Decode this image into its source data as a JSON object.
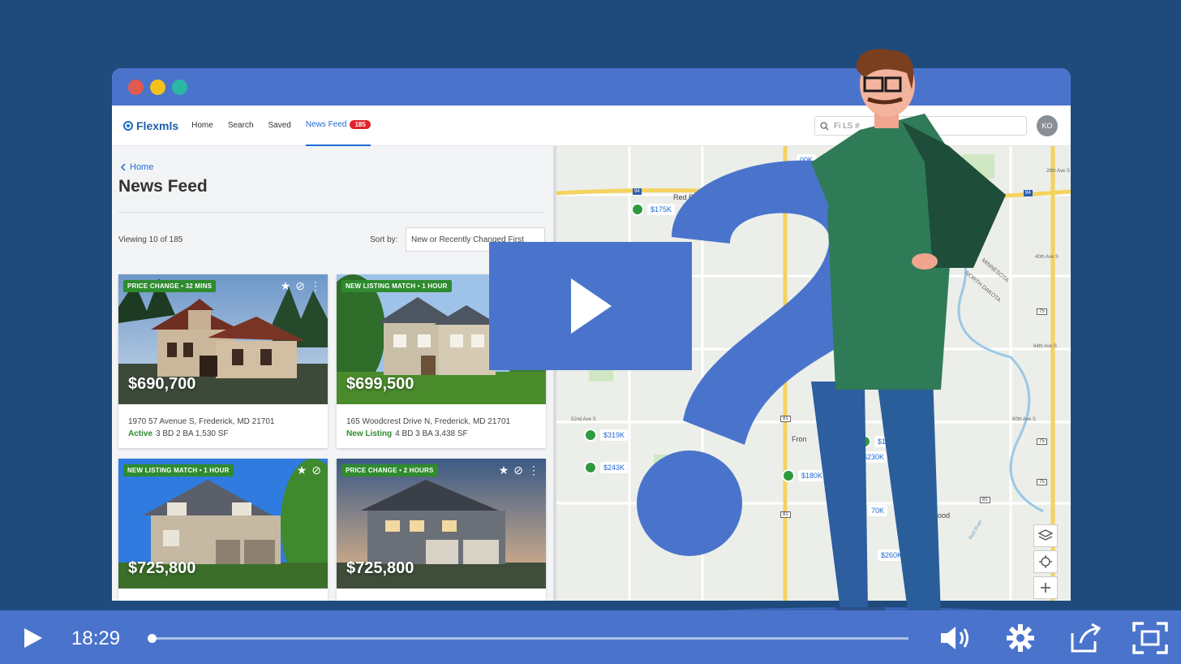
{
  "colors": {
    "background": "#1f4a7c",
    "chrome_blue": "#4a74cc",
    "accent_blue": "#1e6bd6",
    "badge_red": "#e2232e",
    "status_green": "#2e8b2e",
    "window_dots": [
      "#e05a4f",
      "#f3c21c",
      "#2ab7a3"
    ]
  },
  "app": {
    "logo_text": "Flexmls",
    "nav": {
      "home": "Home",
      "search": "Search",
      "saved": "Saved",
      "news_feed": "News Feed",
      "news_feed_count": "185"
    },
    "search_placeholder": "Fi                         LS #",
    "avatar_initials": "KO"
  },
  "feed": {
    "breadcrumb": "Home",
    "title": "News Feed",
    "viewing": "Viewing 10 of 185",
    "sort_label": "Sort by:",
    "sort_value": "New or Recently Changed First"
  },
  "listings": [
    {
      "tag": "PRICE CHANGE • 32 MINS",
      "price": "$690,700",
      "address": "1970 57 Avenue S, Frederick, MD 21701",
      "status": "Active",
      "details": "3 BD   2 BA   1,530 SF"
    },
    {
      "tag": "NEW LISTING MATCH • 1 HOUR",
      "price": "$699,500",
      "address": "165 Woodcrest Drive N, Frederick, MD 21701",
      "status": "New Listing",
      "details": "4 BD   3 BA   3,438 SF"
    },
    {
      "tag": "NEW LISTING MATCH • 1 HOUR",
      "price": "$725,800",
      "address": "",
      "status": "",
      "details": ""
    },
    {
      "tag": "PRICE CHANGE • 2 HOURS",
      "price": "$725,800",
      "address": "",
      "status": "",
      "details": ""
    }
  ],
  "map": {
    "pins": [
      "$175K",
      "$319K",
      "$243K",
      "$180K",
      "$182",
      "$230K",
      "70K",
      "$260K",
      "00K"
    ],
    "labels": [
      "Red R",
      "Fron",
      "ood",
      "52nd Ave S",
      "60th Ave S",
      "MINNESOTA",
      "NORTH DAKOTA",
      "Red River",
      "28th Ave S",
      "40th Ave S",
      "64th Ave S"
    ],
    "route_shields": [
      "94",
      "94",
      "81",
      "81",
      "75",
      "75",
      "75",
      "81"
    ]
  },
  "player": {
    "time": "18:29",
    "progress": 0.003
  }
}
